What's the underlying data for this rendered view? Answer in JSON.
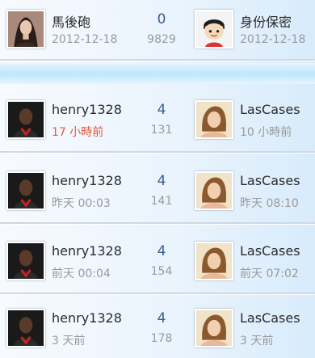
{
  "rows": [
    {
      "left_user": "馬後砲",
      "left_time": "2012-12-18",
      "count": "0",
      "views": "9829",
      "right_user": "身份保密",
      "right_time": "2012-12-18",
      "left_avatar_icon": "woman-avatar-icon",
      "right_avatar_icon": "cartoon-boy-avatar-icon"
    },
    {
      "left_user": "henry1328",
      "left_time": "17 小時前",
      "count": "4",
      "views": "131",
      "right_user": "LasCases",
      "right_time": "10 小時前",
      "left_avatar_icon": "man-avatar-icon",
      "right_avatar_icon": "woman-photo-avatar-icon"
    },
    {
      "left_user": "henry1328",
      "left_time": "昨天 00:03",
      "count": "4",
      "views": "141",
      "right_user": "LasCases",
      "right_time": "昨天 08:10",
      "left_avatar_icon": "man-avatar-icon",
      "right_avatar_icon": "woman-photo-avatar-icon"
    },
    {
      "left_user": "henry1328",
      "left_time": "前天 00:04",
      "count": "4",
      "views": "154",
      "right_user": "LasCases",
      "right_time": "前天 07:02",
      "left_avatar_icon": "man-avatar-icon",
      "right_avatar_icon": "woman-photo-avatar-icon"
    },
    {
      "left_user": "henry1328",
      "left_time": "3 天前",
      "count": "4",
      "views": "178",
      "right_user": "LasCases",
      "right_time": "3 天前",
      "left_avatar_icon": "man-avatar-icon",
      "right_avatar_icon": "woman-photo-avatar-icon"
    }
  ],
  "colors": {
    "highlight_time": "#e05a3a",
    "count": "#3a5f8a",
    "muted": "#9a9a9a"
  }
}
